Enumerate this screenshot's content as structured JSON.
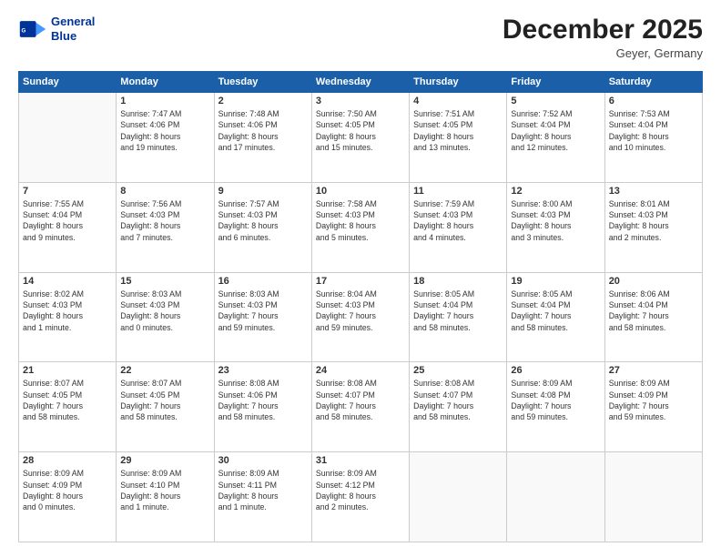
{
  "header": {
    "logo_line1": "General",
    "logo_line2": "Blue",
    "month": "December 2025",
    "location": "Geyer, Germany"
  },
  "days_of_week": [
    "Sunday",
    "Monday",
    "Tuesday",
    "Wednesday",
    "Thursday",
    "Friday",
    "Saturday"
  ],
  "weeks": [
    [
      {
        "day": "",
        "info": ""
      },
      {
        "day": "1",
        "info": "Sunrise: 7:47 AM\nSunset: 4:06 PM\nDaylight: 8 hours\nand 19 minutes."
      },
      {
        "day": "2",
        "info": "Sunrise: 7:48 AM\nSunset: 4:06 PM\nDaylight: 8 hours\nand 17 minutes."
      },
      {
        "day": "3",
        "info": "Sunrise: 7:50 AM\nSunset: 4:05 PM\nDaylight: 8 hours\nand 15 minutes."
      },
      {
        "day": "4",
        "info": "Sunrise: 7:51 AM\nSunset: 4:05 PM\nDaylight: 8 hours\nand 13 minutes."
      },
      {
        "day": "5",
        "info": "Sunrise: 7:52 AM\nSunset: 4:04 PM\nDaylight: 8 hours\nand 12 minutes."
      },
      {
        "day": "6",
        "info": "Sunrise: 7:53 AM\nSunset: 4:04 PM\nDaylight: 8 hours\nand 10 minutes."
      }
    ],
    [
      {
        "day": "7",
        "info": "Sunrise: 7:55 AM\nSunset: 4:04 PM\nDaylight: 8 hours\nand 9 minutes."
      },
      {
        "day": "8",
        "info": "Sunrise: 7:56 AM\nSunset: 4:03 PM\nDaylight: 8 hours\nand 7 minutes."
      },
      {
        "day": "9",
        "info": "Sunrise: 7:57 AM\nSunset: 4:03 PM\nDaylight: 8 hours\nand 6 minutes."
      },
      {
        "day": "10",
        "info": "Sunrise: 7:58 AM\nSunset: 4:03 PM\nDaylight: 8 hours\nand 5 minutes."
      },
      {
        "day": "11",
        "info": "Sunrise: 7:59 AM\nSunset: 4:03 PM\nDaylight: 8 hours\nand 4 minutes."
      },
      {
        "day": "12",
        "info": "Sunrise: 8:00 AM\nSunset: 4:03 PM\nDaylight: 8 hours\nand 3 minutes."
      },
      {
        "day": "13",
        "info": "Sunrise: 8:01 AM\nSunset: 4:03 PM\nDaylight: 8 hours\nand 2 minutes."
      }
    ],
    [
      {
        "day": "14",
        "info": "Sunrise: 8:02 AM\nSunset: 4:03 PM\nDaylight: 8 hours\nand 1 minute."
      },
      {
        "day": "15",
        "info": "Sunrise: 8:03 AM\nSunset: 4:03 PM\nDaylight: 8 hours\nand 0 minutes."
      },
      {
        "day": "16",
        "info": "Sunrise: 8:03 AM\nSunset: 4:03 PM\nDaylight: 7 hours\nand 59 minutes."
      },
      {
        "day": "17",
        "info": "Sunrise: 8:04 AM\nSunset: 4:03 PM\nDaylight: 7 hours\nand 59 minutes."
      },
      {
        "day": "18",
        "info": "Sunrise: 8:05 AM\nSunset: 4:04 PM\nDaylight: 7 hours\nand 58 minutes."
      },
      {
        "day": "19",
        "info": "Sunrise: 8:05 AM\nSunset: 4:04 PM\nDaylight: 7 hours\nand 58 minutes."
      },
      {
        "day": "20",
        "info": "Sunrise: 8:06 AM\nSunset: 4:04 PM\nDaylight: 7 hours\nand 58 minutes."
      }
    ],
    [
      {
        "day": "21",
        "info": "Sunrise: 8:07 AM\nSunset: 4:05 PM\nDaylight: 7 hours\nand 58 minutes."
      },
      {
        "day": "22",
        "info": "Sunrise: 8:07 AM\nSunset: 4:05 PM\nDaylight: 7 hours\nand 58 minutes."
      },
      {
        "day": "23",
        "info": "Sunrise: 8:08 AM\nSunset: 4:06 PM\nDaylight: 7 hours\nand 58 minutes."
      },
      {
        "day": "24",
        "info": "Sunrise: 8:08 AM\nSunset: 4:07 PM\nDaylight: 7 hours\nand 58 minutes."
      },
      {
        "day": "25",
        "info": "Sunrise: 8:08 AM\nSunset: 4:07 PM\nDaylight: 7 hours\nand 58 minutes."
      },
      {
        "day": "26",
        "info": "Sunrise: 8:09 AM\nSunset: 4:08 PM\nDaylight: 7 hours\nand 59 minutes."
      },
      {
        "day": "27",
        "info": "Sunrise: 8:09 AM\nSunset: 4:09 PM\nDaylight: 7 hours\nand 59 minutes."
      }
    ],
    [
      {
        "day": "28",
        "info": "Sunrise: 8:09 AM\nSunset: 4:09 PM\nDaylight: 8 hours\nand 0 minutes."
      },
      {
        "day": "29",
        "info": "Sunrise: 8:09 AM\nSunset: 4:10 PM\nDaylight: 8 hours\nand 1 minute."
      },
      {
        "day": "30",
        "info": "Sunrise: 8:09 AM\nSunset: 4:11 PM\nDaylight: 8 hours\nand 1 minute."
      },
      {
        "day": "31",
        "info": "Sunrise: 8:09 AM\nSunset: 4:12 PM\nDaylight: 8 hours\nand 2 minutes."
      },
      {
        "day": "",
        "info": ""
      },
      {
        "day": "",
        "info": ""
      },
      {
        "day": "",
        "info": ""
      }
    ]
  ]
}
